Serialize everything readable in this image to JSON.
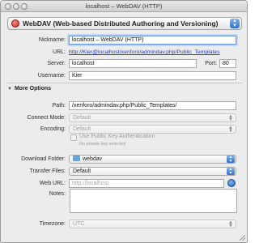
{
  "window": {
    "title": "localhost – WebDAV (HTTP)"
  },
  "protocol": {
    "label": "WebDAV (Web-based Distributed Authoring and Versioning)"
  },
  "form": {
    "nickname": {
      "label": "Nickname:",
      "value": "localhost – WebDAV (HTTP)"
    },
    "url": {
      "label": "URL:",
      "value": "http://Kier@localhost/xenforo/admindav.php/Public_Templates"
    },
    "server": {
      "label": "Server:",
      "value": "localhost"
    },
    "port": {
      "label": "Port:",
      "value": "80"
    },
    "username": {
      "label": "Username:",
      "value": "Kier"
    }
  },
  "more_options": {
    "title": "More Options",
    "path": {
      "label": "Path:",
      "value": "/xenforo/admindav.php/Public_Templates/"
    },
    "connect_mode": {
      "label": "Connect Mode:",
      "value": "Default"
    },
    "encoding": {
      "label": "Encoding:",
      "value": "Default"
    },
    "public_key": {
      "label": "Use Public Key Authentication",
      "hint": "No private key selected"
    },
    "download_folder": {
      "label": "Download Folder:",
      "value": "webdav"
    },
    "transfer_files": {
      "label": "Transfer Files:",
      "value": "Default"
    },
    "web_url": {
      "label": "Web URL:",
      "placeholder": "http://localhost"
    },
    "notes": {
      "label": "Notes:"
    },
    "timezone": {
      "label": "Timezone:",
      "value": "UTC"
    }
  },
  "icons": {
    "protocol": "webdav-protocol-icon",
    "folder": "folder-icon",
    "web": "globe-icon"
  }
}
